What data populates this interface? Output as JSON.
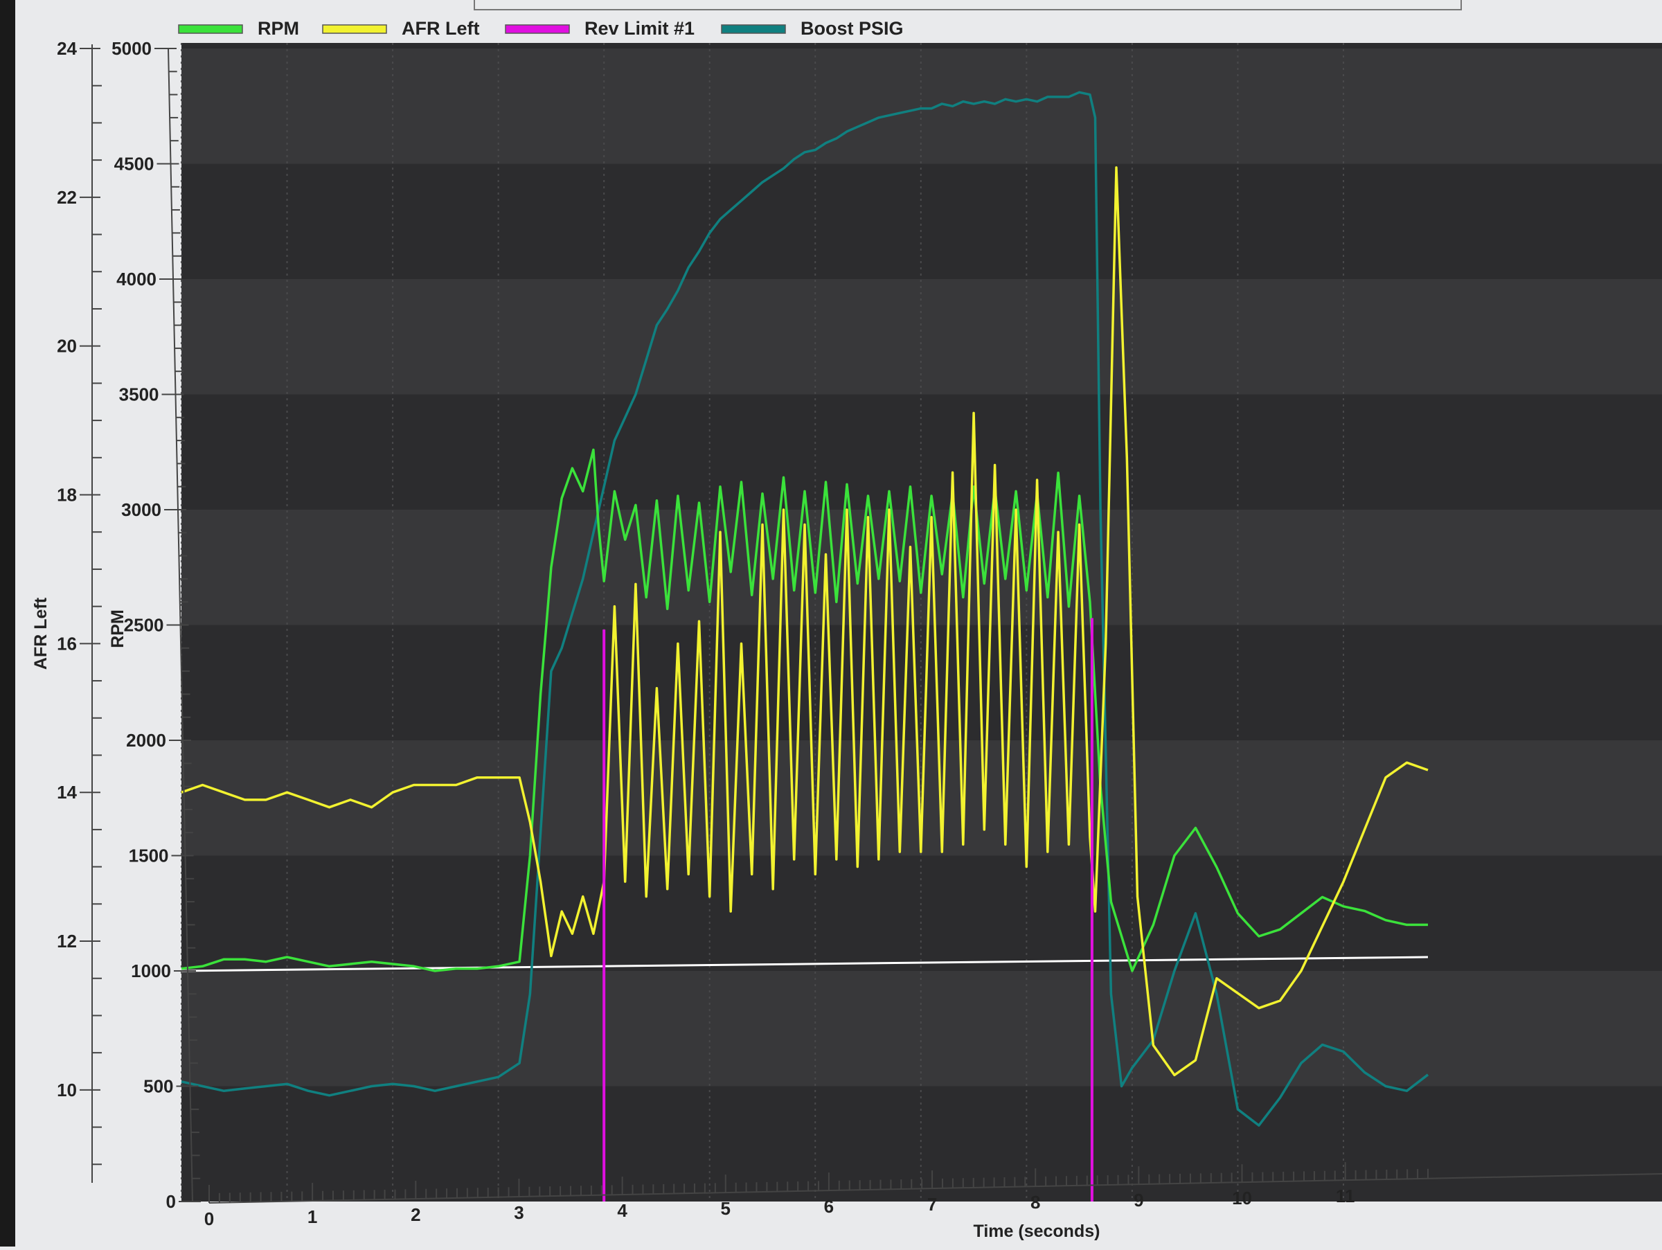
{
  "chart_data": {
    "type": "line",
    "legend": {
      "position": "top-left",
      "entries": [
        {
          "label": "RPM",
          "color": "#3be23b"
        },
        {
          "label": "AFR Left",
          "color": "#f2f230"
        },
        {
          "label": "Rev Limit #1",
          "color": "#e010e0"
        },
        {
          "label": "Boost PSIG",
          "color": "#108080"
        }
      ]
    },
    "xlabel": "Time (seconds)",
    "x_ticks": [
      "0",
      "1",
      "2",
      "3",
      "4",
      "5",
      "6",
      "7",
      "8",
      "9",
      "10",
      "11"
    ],
    "xlim": [
      0,
      11.8
    ],
    "y_axes": [
      {
        "name": "AFR Left",
        "label": "AFR Left",
        "ticks": [
          "10",
          "12",
          "14",
          "16",
          "18",
          "20",
          "22",
          "24"
        ],
        "range": [
          8.5,
          24
        ]
      },
      {
        "name": "RPM",
        "label": "RPM",
        "ticks": [
          "0",
          "500",
          "1000",
          "1500",
          "2000",
          "2500",
          "3000",
          "3500",
          "4000",
          "4500",
          "5000"
        ],
        "range": [
          0,
          5000
        ]
      }
    ],
    "grid": "horizontal bands",
    "series": [
      {
        "name": "RPM",
        "color": "#3be23b",
        "axis": "RPM",
        "x": [
          0,
          0.2,
          0.4,
          0.6,
          0.8,
          1.0,
          1.2,
          1.4,
          1.6,
          1.8,
          2.0,
          2.2,
          2.4,
          2.6,
          2.8,
          3.0,
          3.2,
          3.3,
          3.4,
          3.5,
          3.6,
          3.7,
          3.8,
          3.9,
          3.95,
          4.0,
          4.1,
          4.2,
          4.3,
          4.4,
          4.5,
          4.6,
          4.7,
          4.8,
          4.9,
          5.0,
          5.1,
          5.2,
          5.3,
          5.4,
          5.5,
          5.6,
          5.7,
          5.8,
          5.9,
          6.0,
          6.1,
          6.2,
          6.3,
          6.4,
          6.5,
          6.6,
          6.7,
          6.8,
          6.9,
          7.0,
          7.1,
          7.2,
          7.3,
          7.4,
          7.5,
          7.6,
          7.7,
          7.8,
          7.9,
          8.0,
          8.1,
          8.2,
          8.3,
          8.4,
          8.5,
          8.6,
          8.7,
          8.8,
          9.0,
          9.2,
          9.4,
          9.6,
          9.8,
          10.0,
          10.2,
          10.4,
          10.6,
          10.8,
          11.0,
          11.2,
          11.4,
          11.6,
          11.8
        ],
        "values": [
          1010,
          1020,
          1050,
          1050,
          1040,
          1060,
          1040,
          1020,
          1030,
          1040,
          1030,
          1020,
          1000,
          1010,
          1010,
          1020,
          1040,
          1500,
          2200,
          2750,
          3050,
          3180,
          3080,
          3260,
          2920,
          2690,
          3080,
          2870,
          3020,
          2620,
          3040,
          2570,
          3060,
          2650,
          3030,
          2600,
          3100,
          2730,
          3120,
          2630,
          3070,
          2700,
          3140,
          2650,
          3080,
          2640,
          3120,
          2600,
          3110,
          2680,
          3060,
          2700,
          3080,
          2690,
          3100,
          2640,
          3060,
          2720,
          3070,
          2620,
          3100,
          2680,
          3090,
          2700,
          3080,
          2650,
          3070,
          2620,
          3160,
          2580,
          3060,
          2600,
          1800,
          1300,
          1000,
          1200,
          1500,
          1620,
          1450,
          1250,
          1150,
          1180,
          1250,
          1320,
          1280,
          1260,
          1220,
          1200,
          1200
        ]
      },
      {
        "name": "AFR Left",
        "color": "#f2f230",
        "axis": "AFR Left",
        "x": [
          0,
          0.2,
          0.4,
          0.6,
          0.8,
          1.0,
          1.2,
          1.4,
          1.6,
          1.8,
          2.0,
          2.2,
          2.4,
          2.6,
          2.8,
          3.0,
          3.2,
          3.3,
          3.4,
          3.5,
          3.6,
          3.7,
          3.8,
          3.9,
          4.0,
          4.1,
          4.2,
          4.3,
          4.4,
          4.5,
          4.6,
          4.7,
          4.8,
          4.9,
          5.0,
          5.1,
          5.2,
          5.3,
          5.4,
          5.5,
          5.6,
          5.7,
          5.8,
          5.9,
          6.0,
          6.1,
          6.2,
          6.3,
          6.4,
          6.5,
          6.6,
          6.7,
          6.8,
          6.9,
          7.0,
          7.1,
          7.2,
          7.3,
          7.4,
          7.5,
          7.6,
          7.7,
          7.8,
          7.9,
          8.0,
          8.1,
          8.2,
          8.3,
          8.4,
          8.5,
          8.6,
          8.65,
          8.75,
          8.85,
          8.95,
          9.05,
          9.2,
          9.4,
          9.6,
          9.8,
          10.0,
          10.2,
          10.4,
          10.6,
          10.8,
          11.0,
          11.2,
          11.4,
          11.6,
          11.8
        ],
        "values": [
          14.0,
          14.1,
          14.0,
          13.9,
          13.9,
          14.0,
          13.9,
          13.8,
          13.9,
          13.8,
          14.0,
          14.1,
          14.1,
          14.1,
          14.2,
          14.2,
          14.2,
          13.6,
          12.8,
          11.8,
          12.4,
          12.1,
          12.6,
          12.1,
          12.8,
          16.5,
          12.8,
          16.8,
          12.6,
          15.4,
          12.7,
          16.0,
          12.9,
          16.3,
          12.6,
          17.5,
          12.4,
          16.0,
          12.9,
          17.6,
          12.7,
          17.8,
          13.1,
          17.6,
          12.9,
          17.2,
          13.1,
          17.8,
          13.0,
          17.7,
          13.1,
          17.8,
          13.2,
          17.3,
          13.2,
          17.7,
          13.2,
          18.3,
          13.3,
          19.1,
          13.5,
          18.4,
          13.3,
          17.8,
          13.0,
          18.2,
          13.2,
          17.5,
          13.3,
          17.6,
          13.4,
          12.4,
          16.0,
          22.4,
          18.5,
          12.6,
          10.6,
          10.2,
          10.4,
          11.5,
          11.3,
          11.1,
          11.2,
          11.6,
          12.2,
          12.8,
          13.5,
          14.2,
          14.4,
          14.3
        ]
      },
      {
        "name": "Boost PSIG",
        "color": "#108080",
        "axis": "RPM",
        "x": [
          0,
          0.2,
          0.4,
          0.6,
          0.8,
          1.0,
          1.2,
          1.4,
          1.6,
          1.8,
          2.0,
          2.2,
          2.4,
          2.6,
          2.8,
          3.0,
          3.2,
          3.3,
          3.4,
          3.5,
          3.6,
          3.7,
          3.8,
          3.9,
          4.0,
          4.1,
          4.2,
          4.3,
          4.4,
          4.5,
          4.6,
          4.7,
          4.8,
          4.9,
          5.0,
          5.1,
          5.2,
          5.3,
          5.4,
          5.5,
          5.6,
          5.7,
          5.8,
          5.9,
          6.0,
          6.1,
          6.2,
          6.3,
          6.4,
          6.5,
          6.6,
          6.7,
          6.8,
          6.9,
          7.0,
          7.1,
          7.2,
          7.3,
          7.4,
          7.5,
          7.6,
          7.7,
          7.8,
          7.9,
          8.0,
          8.1,
          8.2,
          8.3,
          8.4,
          8.5,
          8.6,
          8.65,
          8.7,
          8.8,
          8.9,
          9.0,
          9.2,
          9.4,
          9.6,
          9.8,
          10.0,
          10.2,
          10.4,
          10.6,
          10.8,
          11.0,
          11.2,
          11.4,
          11.6,
          11.8
        ],
        "values": [
          520,
          500,
          480,
          490,
          500,
          510,
          480,
          460,
          480,
          500,
          510,
          500,
          480,
          500,
          520,
          540,
          600,
          900,
          1600,
          2300,
          2400,
          2550,
          2700,
          2900,
          3100,
          3300,
          3400,
          3500,
          3650,
          3800,
          3870,
          3950,
          4050,
          4120,
          4200,
          4260,
          4300,
          4340,
          4380,
          4420,
          4450,
          4480,
          4520,
          4550,
          4560,
          4590,
          4610,
          4640,
          4660,
          4680,
          4700,
          4710,
          4720,
          4730,
          4740,
          4740,
          4760,
          4750,
          4770,
          4760,
          4770,
          4760,
          4780,
          4770,
          4780,
          4770,
          4790,
          4790,
          4790,
          4810,
          4800,
          4700,
          3000,
          900,
          500,
          580,
          700,
          1000,
          1250,
          900,
          400,
          330,
          450,
          600,
          680,
          650,
          560,
          500,
          480,
          550
        ]
      },
      {
        "name": "Rev Limit #1",
        "color": "#e010e0",
        "axis": "RPM",
        "segments": [
          {
            "x": [
              4.0,
              4.0
            ],
            "values": [
              2480,
              0
            ]
          },
          {
            "x": [
              8.62,
              8.62
            ],
            "values": [
              2530,
              0
            ]
          }
        ]
      }
    ],
    "reference_line": {
      "color": "#ffffff",
      "axis": "RPM",
      "x": [
        0,
        11.8
      ],
      "values": [
        1000,
        1060
      ]
    }
  }
}
